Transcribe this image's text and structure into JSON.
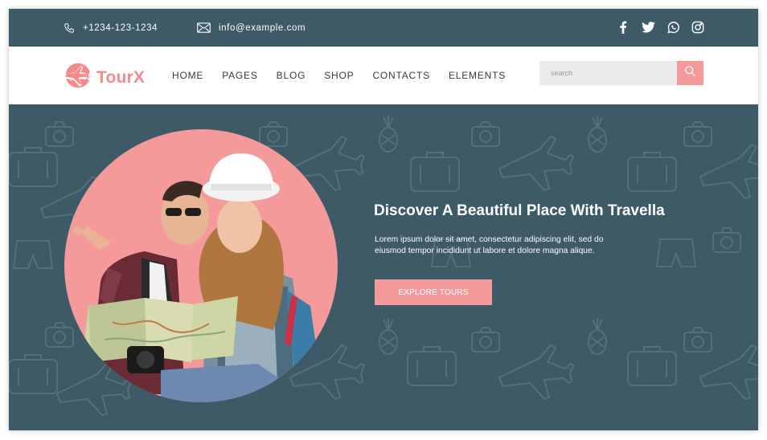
{
  "topbar": {
    "phone": "+1234-123-1234",
    "email": "info@example.com",
    "social_icons": [
      "facebook-icon",
      "twitter-icon",
      "whatsapp-icon",
      "instagram-icon"
    ]
  },
  "brand": {
    "name": "TourX",
    "color": "#f58a8c"
  },
  "nav": {
    "items": [
      {
        "label": "HOME"
      },
      {
        "label": "PAGES"
      },
      {
        "label": "BLOG"
      },
      {
        "label": "SHOP"
      },
      {
        "label": "CONTACTS"
      },
      {
        "label": "ELEMENTS"
      }
    ]
  },
  "search": {
    "placeholder": "search",
    "value": ""
  },
  "hero": {
    "title": "Discover A Beautiful Place With Travella",
    "description": "Lorem ipsum dolor sit amet, consectetur adipiscing elit, sed do eiusmod tempor incididunt ut labore et dolore magna alique.",
    "button_label": "EXPLORE TOURS"
  },
  "colors": {
    "dark_teal": "#3d5a66",
    "accent_pink": "#f59a9b",
    "white": "#ffffff"
  }
}
